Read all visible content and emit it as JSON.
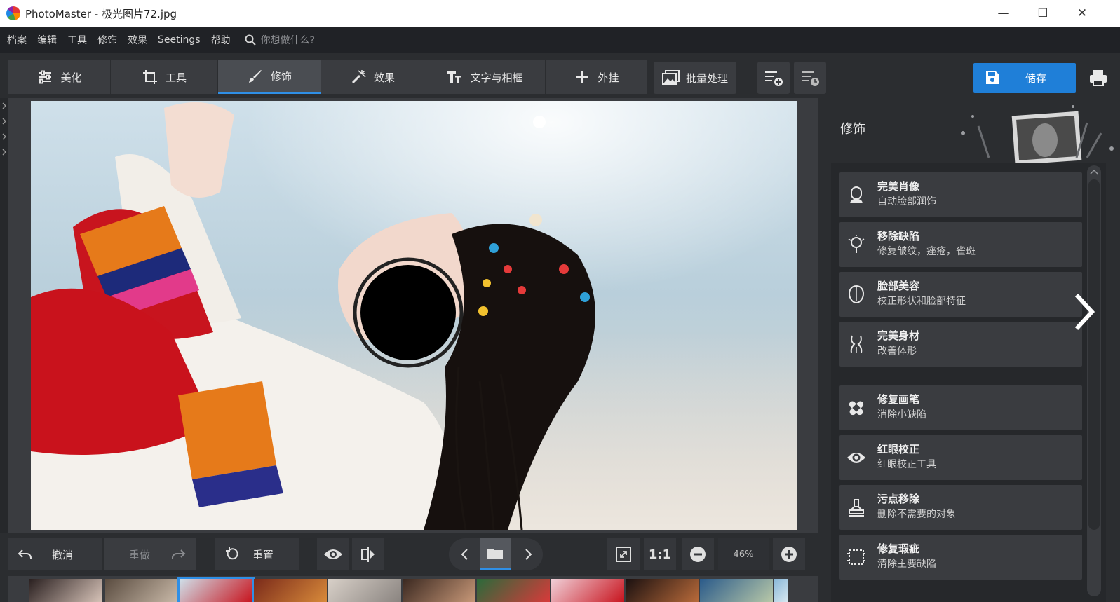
{
  "window": {
    "title": "PhotoMaster - 极光图片72.jpg",
    "minimize": "—",
    "maximize": "☐",
    "close": "✕"
  },
  "menu": {
    "items": [
      "档案",
      "编辑",
      "工具",
      "修饰",
      "效果",
      "Seetings",
      "帮助"
    ],
    "search_placeholder": "你想做什么?"
  },
  "tabs": [
    {
      "label": "美化",
      "icon": "sliders-icon",
      "active": false
    },
    {
      "label": "工具",
      "icon": "crop-icon",
      "active": false
    },
    {
      "label": "修饰",
      "icon": "brush-icon",
      "active": true
    },
    {
      "label": "效果",
      "icon": "magic-icon",
      "active": false
    },
    {
      "label": "文字与相框",
      "icon": "text-icon",
      "active": false
    },
    {
      "label": "外挂",
      "icon": "plus-icon",
      "active": false
    }
  ],
  "toolbar": {
    "batch_label": "批量处理",
    "save_label": "储存"
  },
  "panel": {
    "title": "修饰",
    "items": [
      {
        "title": "完美肖像",
        "subtitle": "自动脸部润饰",
        "icon": "portrait-icon"
      },
      {
        "title": "移除缺陷",
        "subtitle": "修复皱纹，痤疮，雀斑",
        "icon": "blemish-icon"
      },
      {
        "title": "脸部美容",
        "subtitle": "校正形状和脸部特征",
        "icon": "face-shape-icon"
      },
      {
        "title": "完美身材",
        "subtitle": "改善体形",
        "icon": "body-icon"
      },
      {
        "title": "修复画笔",
        "subtitle": "消除小缺陷",
        "icon": "bandage-icon"
      },
      {
        "title": "红眼校正",
        "subtitle": "红眼校正工具",
        "icon": "eye-icon"
      },
      {
        "title": "污点移除",
        "subtitle": "删除不需要的对象",
        "icon": "stamp-icon"
      },
      {
        "title": "修复瑕疵",
        "subtitle": "清除主要缺陷",
        "icon": "patch-icon"
      }
    ]
  },
  "bottom": {
    "undo_label": "撤消",
    "redo_label": "重做",
    "reset_label": "重置",
    "one_to_one": "1:1",
    "zoom": "46%"
  },
  "colors": {
    "accent": "#1f7fd8",
    "panel_bg": "#2b2d30",
    "card_bg": "#3a3c40"
  }
}
